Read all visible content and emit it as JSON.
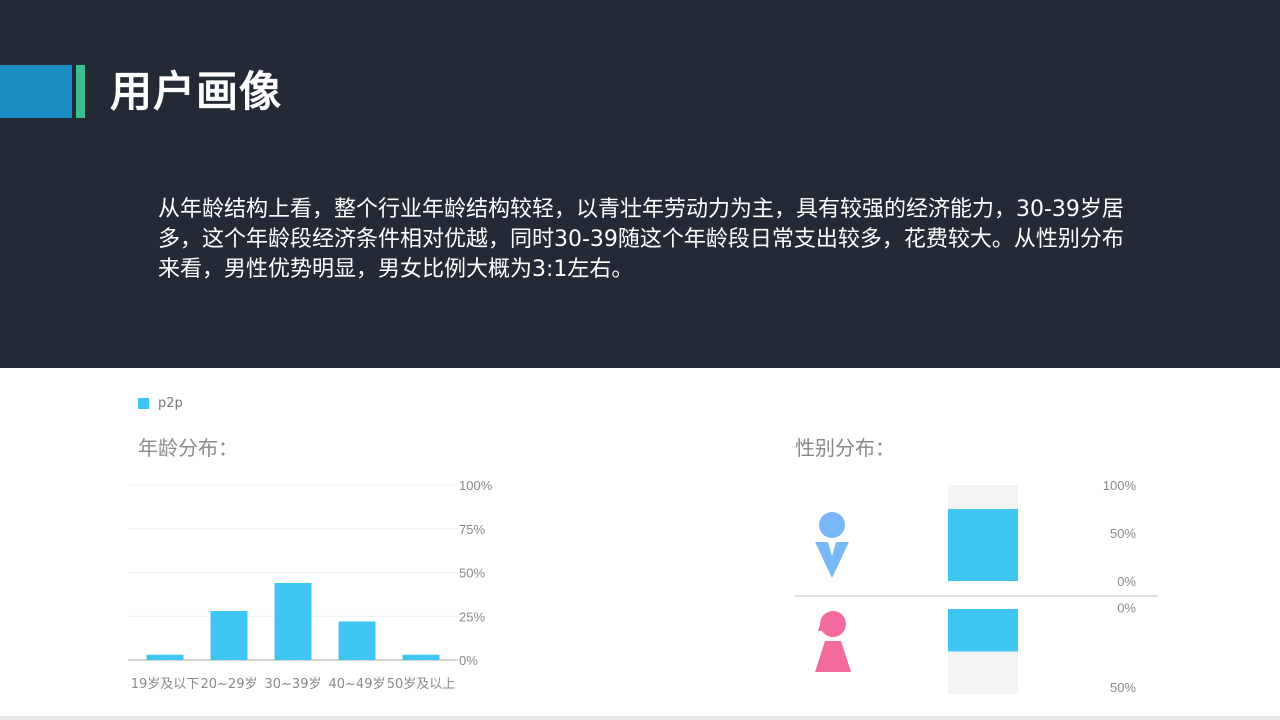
{
  "slide": {
    "title": "用户画像",
    "description": "从年龄结构上看，整个行业年龄结构较轻，以青壮年劳动力为主，具有较强的经济能力，30-39岁居多，这个年龄段经济条件相对优越，同时30-39随这个年龄段日常支出较多，花费较大。从性别分布来看，男性优势明显，男女比例大概为3:1左右。"
  },
  "legend": {
    "label": "p2p",
    "color": "#3ec6f2"
  },
  "chart_data": [
    {
      "type": "bar",
      "title": "年龄分布：",
      "categories": [
        "19岁及以下",
        "20~29岁",
        "30~39岁",
        "40~49岁",
        "50岁及以上"
      ],
      "series": [
        {
          "name": "p2p",
          "values": [
            3,
            28,
            44,
            22,
            3
          ]
        }
      ],
      "ylim": [
        0,
        100
      ],
      "yticks": [
        "0%",
        "25%",
        "50%",
        "75%",
        "100%"
      ],
      "grid": true,
      "legend_position": "top-left",
      "bar_color": "#3ec6f2"
    },
    {
      "type": "bar",
      "title": "性别分布：",
      "categories": [
        "男",
        "女"
      ],
      "series": [
        {
          "name": "p2p",
          "values": [
            75,
            25
          ]
        }
      ],
      "male_ylim": [
        0,
        100
      ],
      "male_ticks": [
        "0%",
        "50%",
        "100%"
      ],
      "female_ticks": [
        "0%",
        "50%"
      ],
      "male_icon": "male-person-icon",
      "female_icon": "female-person-icon",
      "male_color": "#79b8f7",
      "female_color": "#f36b9c",
      "bar_color": "#3ec6f2",
      "track_color": "#f3f3f3"
    }
  ]
}
